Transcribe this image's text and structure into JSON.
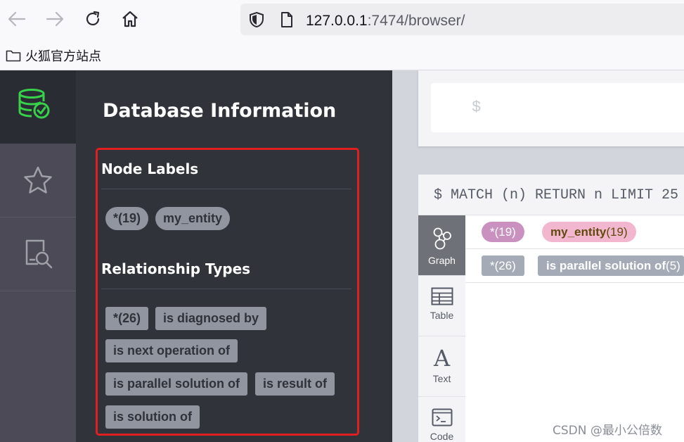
{
  "browser": {
    "url_host": "127.0.0.1",
    "url_path": ":7474/browser/",
    "bookmark_label": "火狐官方站点"
  },
  "drawer": {
    "title": "Database Information",
    "node_labels_heading": "Node Labels",
    "node_labels": [
      "*(19)",
      "my_entity"
    ],
    "relationship_types_heading": "Relationship Types",
    "relationship_types": [
      "*(26)",
      "is diagnosed by",
      "is next operation of",
      "is parallel solution of",
      "is result of",
      "is solution of"
    ]
  },
  "editor": {
    "prompt": "$"
  },
  "frame": {
    "query": "$ MATCH (n) RETURN n LIMIT 25",
    "tabs": [
      {
        "label": "Graph"
      },
      {
        "label": "Table"
      },
      {
        "label": "Text"
      },
      {
        "label": "Code"
      }
    ],
    "node_tags": [
      {
        "label": "*(19)"
      },
      {
        "label": "my_entity",
        "count": "(19)"
      }
    ],
    "rel_tags": [
      {
        "label": "*(26)"
      },
      {
        "label": "is parallel solution of",
        "count": "(5)"
      }
    ]
  },
  "colors": {
    "node_all": "#c990c0",
    "my_entity": "#f2b7ce",
    "rel_tag": "#a5abb6",
    "highlight_box": "#e02020",
    "db_icon": "#37d24a"
  },
  "watermark": "CSDN @最小公倍数"
}
